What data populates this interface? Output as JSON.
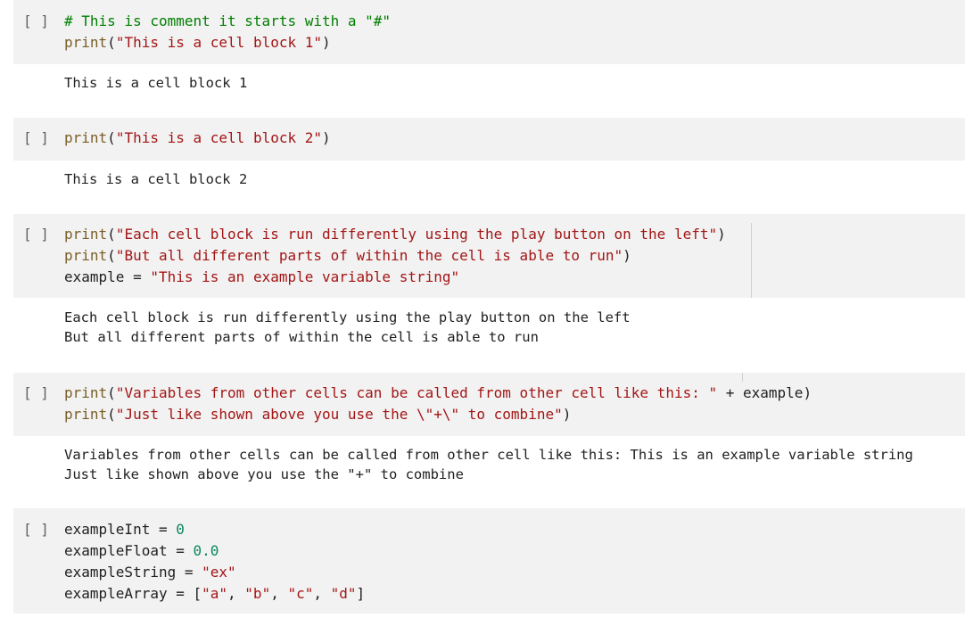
{
  "run_label": "[ ]",
  "cells": [
    {
      "code_lines": [
        [
          {
            "t": "# This is comment it starts with a \"#\"",
            "c": "k-c"
          }
        ],
        [
          {
            "t": "print",
            "c": "k-f"
          },
          {
            "t": "(",
            "c": "k-p"
          },
          {
            "t": "\"This is a cell block 1\"",
            "c": "k-s"
          },
          {
            "t": ")",
            "c": "k-p"
          }
        ]
      ],
      "output": [
        "This is a cell block 1"
      ]
    },
    {
      "code_lines": [
        [
          {
            "t": "print",
            "c": "k-f"
          },
          {
            "t": "(",
            "c": "k-p"
          },
          {
            "t": "\"This is a cell block 2\"",
            "c": "k-s"
          },
          {
            "t": ")",
            "c": "k-p"
          }
        ]
      ],
      "output": [
        "This is a cell block 2"
      ]
    },
    {
      "code_lines": [
        [
          {
            "t": "print",
            "c": "k-f"
          },
          {
            "t": "(",
            "c": "k-p"
          },
          {
            "t": "\"Each cell block is run differently using the play button on the left\"",
            "c": "k-s"
          },
          {
            "t": ")",
            "c": "k-p"
          }
        ],
        [
          {
            "t": "print",
            "c": "k-f"
          },
          {
            "t": "(",
            "c": "k-p"
          },
          {
            "t": "\"But all different parts of within the cell is able to run\"",
            "c": "k-s"
          },
          {
            "t": ")",
            "c": "k-p"
          }
        ],
        [
          {
            "t": "example",
            "c": "k-v"
          },
          {
            "t": " = ",
            "c": "k-p"
          },
          {
            "t": "\"This is an example variable string\"",
            "c": "k-s"
          }
        ]
      ],
      "output": [
        "Each cell block is run differently using the play button on the left",
        "But all different parts of within the cell is able to run"
      ]
    },
    {
      "code_lines": [
        [
          {
            "t": "print",
            "c": "k-f"
          },
          {
            "t": "(",
            "c": "k-p"
          },
          {
            "t": "\"Variables from other cells can be called from other cell like this: \"",
            "c": "k-s"
          },
          {
            "t": " + example)",
            "c": "k-p"
          }
        ],
        [
          {
            "t": "print",
            "c": "k-f"
          },
          {
            "t": "(",
            "c": "k-p"
          },
          {
            "t": "\"Just like shown above you use the \\\"+\\\" to combine\"",
            "c": "k-s"
          },
          {
            "t": ")",
            "c": "k-p"
          }
        ]
      ],
      "output": [
        "Variables from other cells can be called from other cell like this: This is an example variable string",
        "Just like shown above you use the \"+\" to combine"
      ]
    },
    {
      "code_lines": [
        [
          {
            "t": "exampleInt",
            "c": "k-v"
          },
          {
            "t": " = ",
            "c": "k-p"
          },
          {
            "t": "0",
            "c": "k-n"
          }
        ],
        [
          {
            "t": "exampleFloat",
            "c": "k-v"
          },
          {
            "t": " = ",
            "c": "k-p"
          },
          {
            "t": "0.0",
            "c": "k-n"
          }
        ],
        [
          {
            "t": "exampleString",
            "c": "k-v"
          },
          {
            "t": " = ",
            "c": "k-p"
          },
          {
            "t": "\"ex\"",
            "c": "k-s"
          }
        ],
        [
          {
            "t": "exampleArray",
            "c": "k-v"
          },
          {
            "t": " = [",
            "c": "k-p"
          },
          {
            "t": "\"a\"",
            "c": "k-s"
          },
          {
            "t": ", ",
            "c": "k-p"
          },
          {
            "t": "\"b\"",
            "c": "k-s"
          },
          {
            "t": ", ",
            "c": "k-p"
          },
          {
            "t": "\"c\"",
            "c": "k-s"
          },
          {
            "t": ", ",
            "c": "k-p"
          },
          {
            "t": "\"d\"",
            "c": "k-s"
          },
          {
            "t": "]",
            "c": "k-p"
          }
        ]
      ],
      "output": []
    }
  ]
}
